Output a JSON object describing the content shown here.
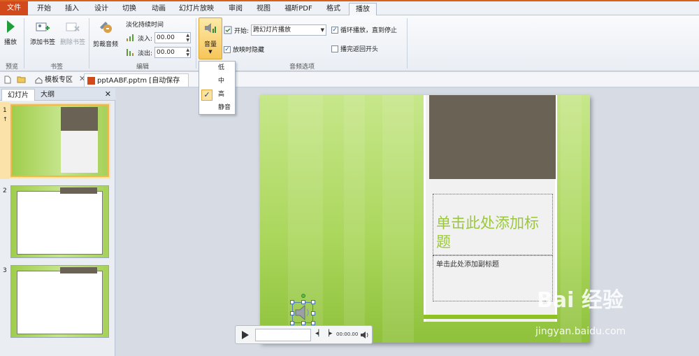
{
  "tabs": [
    "文件",
    "开始",
    "插入",
    "设计",
    "切换",
    "动画",
    "幻灯片放映",
    "审阅",
    "视图",
    "福昕PDF",
    "格式",
    "播放"
  ],
  "ribbon": {
    "play_label": "播放",
    "add_bookmark": "添加书签",
    "remove_bookmark": "删除书签",
    "trim_audio": "剪裁音频",
    "fade_title": "淡化持续时间",
    "fade_in_label": "淡入:",
    "fade_in_value": "00.00",
    "fade_out_label": "淡出:",
    "fade_out_value": "00.00",
    "volume": "音量",
    "start_label": "开始:",
    "start_value": "跨幻灯片播放",
    "hide_label": "放映时隐藏",
    "loop_label": "循环播放，直到停止",
    "rewind_label": "播完返回开头",
    "groups": {
      "preview": "预览",
      "bookmarks": "书签",
      "edit": "编辑",
      "audio_options": "音频选项"
    }
  },
  "volume_menu": [
    "低",
    "中",
    "高",
    "静音"
  ],
  "doc_tabs": {
    "template": "模板专区",
    "file": "pptAABF.pptm [自动保存的]"
  },
  "panel_tabs": {
    "slides": "幻灯片",
    "outline": "大纲",
    "close": "✕"
  },
  "thumbs": [
    "1",
    "2",
    "3"
  ],
  "thumb1_extra": "↑",
  "slide": {
    "title_placeholder": "单击此处添加标题",
    "subtitle_placeholder": "单击此处添加副标题"
  },
  "player": {
    "time": "00:00.00"
  },
  "watermark": {
    "logo": "Bai 经验",
    "url": "jingyan.baidu.com"
  }
}
